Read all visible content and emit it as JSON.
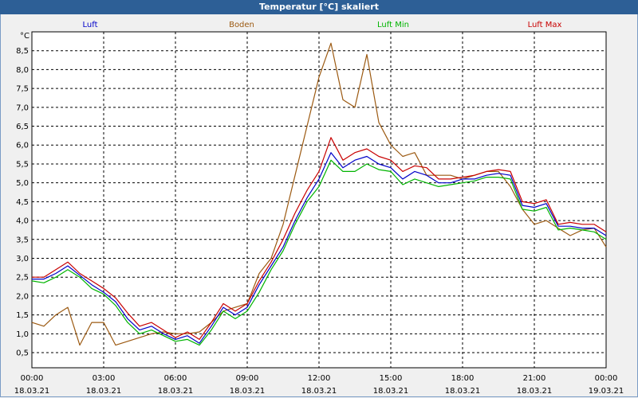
{
  "window": {
    "title": "Temperatur [°C] skaliert"
  },
  "chart_data": {
    "type": "line",
    "title": "Temperatur [°C] skaliert",
    "ylabel": "°C",
    "ylim": [
      0.1,
      9.0
    ],
    "grid": true,
    "legend_position": "top",
    "x": [
      0,
      0.5,
      1,
      1.5,
      2,
      2.5,
      3,
      3.5,
      4,
      4.5,
      5,
      5.5,
      6,
      6.5,
      7,
      7.5,
      8,
      8.5,
      9,
      9.5,
      10,
      10.5,
      11,
      11.5,
      12,
      12.5,
      13,
      13.5,
      14,
      14.5,
      15,
      15.5,
      16,
      16.5,
      17,
      17.5,
      18,
      18.5,
      19,
      19.5,
      20,
      20.5,
      21,
      21.5,
      22,
      22.5,
      23,
      23.5,
      24
    ],
    "x_tick_values": [
      0,
      3,
      6,
      9,
      12,
      15,
      18,
      21,
      24
    ],
    "x_tick_times": [
      "00:00",
      "03:00",
      "06:00",
      "09:00",
      "12:00",
      "15:00",
      "18:00",
      "21:00",
      "00:00"
    ],
    "x_tick_dates": [
      "18.03.21",
      "18.03.21",
      "18.03.21",
      "18.03.21",
      "18.03.21",
      "18.03.21",
      "18.03.21",
      "18.03.21",
      "19.03.21"
    ],
    "y_ticks": [
      "0,5",
      "1,0",
      "1,5",
      "2,0",
      "2,5",
      "3,0",
      "3,5",
      "4,0",
      "4,5",
      "5,0",
      "5,5",
      "6,0",
      "6,5",
      "7,0",
      "7,5",
      "8,0",
      "8,5"
    ],
    "y_tick_values": [
      0.5,
      1.0,
      1.5,
      2.0,
      2.5,
      3.0,
      3.5,
      4.0,
      4.5,
      5.0,
      5.5,
      6.0,
      6.5,
      7.0,
      7.5,
      8.0,
      8.5
    ],
    "series": [
      {
        "name": "Luft",
        "color": "#0000c8",
        "values": [
          2.45,
          2.45,
          2.6,
          2.8,
          2.55,
          2.3,
          2.1,
          1.85,
          1.4,
          1.1,
          1.2,
          1.0,
          0.85,
          0.95,
          0.75,
          1.2,
          1.7,
          1.5,
          1.7,
          2.3,
          2.8,
          3.3,
          4.0,
          4.6,
          5.1,
          5.8,
          5.4,
          5.6,
          5.7,
          5.5,
          5.4,
          5.1,
          5.3,
          5.2,
          5.0,
          5.0,
          5.1,
          5.1,
          5.2,
          5.25,
          5.2,
          4.4,
          4.35,
          4.45,
          3.85,
          3.85,
          3.8,
          3.8,
          3.6
        ]
      },
      {
        "name": "Boden",
        "color": "#9c5a12",
        "values": [
          1.3,
          1.2,
          1.5,
          1.7,
          0.7,
          1.3,
          1.3,
          0.7,
          0.8,
          0.9,
          1.0,
          1.05,
          1.0,
          1.0,
          1.05,
          1.3,
          1.6,
          1.7,
          1.8,
          2.6,
          3.0,
          3.9,
          5.2,
          6.5,
          7.8,
          8.7,
          7.2,
          7.0,
          8.4,
          6.6,
          6.0,
          5.7,
          5.8,
          5.2,
          5.2,
          5.2,
          5.1,
          5.2,
          5.3,
          5.3,
          4.9,
          4.3,
          3.9,
          4.0,
          3.8,
          3.6,
          3.75,
          3.8,
          3.3
        ]
      },
      {
        "name": "Luft Min",
        "color": "#00b400",
        "values": [
          2.4,
          2.35,
          2.5,
          2.7,
          2.5,
          2.2,
          2.05,
          1.75,
          1.3,
          1.0,
          1.1,
          0.95,
          0.8,
          0.85,
          0.7,
          1.1,
          1.6,
          1.4,
          1.6,
          2.1,
          2.7,
          3.2,
          3.9,
          4.5,
          4.9,
          5.6,
          5.3,
          5.3,
          5.5,
          5.35,
          5.3,
          4.95,
          5.1,
          5.0,
          4.9,
          4.95,
          5.0,
          5.05,
          5.15,
          5.15,
          5.1,
          4.3,
          4.25,
          4.35,
          3.75,
          3.8,
          3.75,
          3.7,
          3.5
        ]
      },
      {
        "name": "Luft Max",
        "color": "#c80000",
        "values": [
          2.5,
          2.5,
          2.7,
          2.9,
          2.6,
          2.4,
          2.2,
          1.95,
          1.55,
          1.2,
          1.3,
          1.1,
          0.9,
          1.05,
          0.85,
          1.3,
          1.8,
          1.6,
          1.8,
          2.4,
          2.9,
          3.5,
          4.2,
          4.8,
          5.3,
          6.2,
          5.6,
          5.8,
          5.9,
          5.7,
          5.6,
          5.3,
          5.45,
          5.4,
          5.1,
          5.1,
          5.15,
          5.2,
          5.3,
          5.35,
          5.3,
          4.5,
          4.45,
          4.55,
          3.9,
          3.95,
          3.9,
          3.9,
          3.7
        ]
      }
    ]
  }
}
